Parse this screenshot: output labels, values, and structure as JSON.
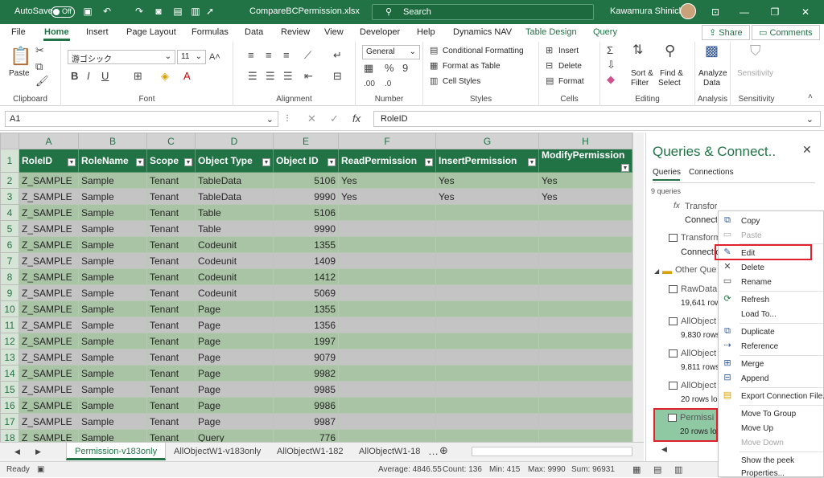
{
  "titlebar": {
    "autosave": "AutoSave",
    "toggle": "Off",
    "filename": "CompareBCPermission.xlsx",
    "search": "Search",
    "user": "Kawamura Shinichi"
  },
  "menu": {
    "items": [
      "File",
      "Home",
      "Insert",
      "Page Layout",
      "Formulas",
      "Data",
      "Review",
      "View",
      "Developer",
      "Help",
      "Dynamics NAV"
    ],
    "context": [
      "Table Design",
      "Query"
    ],
    "share": "Share",
    "comments": "Comments"
  },
  "ribbon": {
    "clipboard": {
      "label": "Clipboard",
      "paste": "Paste"
    },
    "font": {
      "label": "Font",
      "name": "游ゴシック",
      "size": "11"
    },
    "alignment": {
      "label": "Alignment"
    },
    "number": {
      "label": "Number",
      "format": "General"
    },
    "styles": {
      "label": "Styles",
      "conditional": "Conditional Formatting",
      "format_table": "Format as Table",
      "cell_styles": "Cell Styles"
    },
    "cells": {
      "label": "Cells",
      "insert": "Insert",
      "delete": "Delete",
      "format": "Format"
    },
    "editing": {
      "label": "Editing",
      "sort": "Sort &",
      "filter": "Filter",
      "find": "Find &",
      "select": "Select"
    },
    "analysis": {
      "label": "Analysis",
      "analyze": "Analyze",
      "data": "Data"
    },
    "sensitivity": {
      "label": "Sensitivity",
      "btn": "Sensitivity"
    }
  },
  "formula_bar": {
    "cell": "A1",
    "value": "RoleID"
  },
  "sheet": {
    "columns": [
      "A",
      "B",
      "C",
      "D",
      "E",
      "F",
      "G",
      "H"
    ],
    "headers": [
      "RoleID",
      "RoleName",
      "Scope",
      "Object Type",
      "Object ID",
      "ReadPermission",
      "InsertPermission",
      "ModifyPermission"
    ],
    "rows": [
      {
        "n": "2",
        "cells": [
          "Z_SAMPLE",
          "Sample",
          "Tenant",
          "TableData",
          "5106",
          "Yes",
          "Yes",
          "Yes"
        ]
      },
      {
        "n": "3",
        "cells": [
          "Z_SAMPLE",
          "Sample",
          "Tenant",
          "TableData",
          "9990",
          "Yes",
          "Yes",
          "Yes"
        ]
      },
      {
        "n": "4",
        "cells": [
          "Z_SAMPLE",
          "Sample",
          "Tenant",
          "Table",
          "5106",
          "",
          "",
          ""
        ]
      },
      {
        "n": "5",
        "cells": [
          "Z_SAMPLE",
          "Sample",
          "Tenant",
          "Table",
          "9990",
          "",
          "",
          ""
        ]
      },
      {
        "n": "6",
        "cells": [
          "Z_SAMPLE",
          "Sample",
          "Tenant",
          "Codeunit",
          "1355",
          "",
          "",
          ""
        ]
      },
      {
        "n": "7",
        "cells": [
          "Z_SAMPLE",
          "Sample",
          "Tenant",
          "Codeunit",
          "1409",
          "",
          "",
          ""
        ]
      },
      {
        "n": "8",
        "cells": [
          "Z_SAMPLE",
          "Sample",
          "Tenant",
          "Codeunit",
          "1412",
          "",
          "",
          ""
        ]
      },
      {
        "n": "9",
        "cells": [
          "Z_SAMPLE",
          "Sample",
          "Tenant",
          "Codeunit",
          "5069",
          "",
          "",
          ""
        ]
      },
      {
        "n": "10",
        "cells": [
          "Z_SAMPLE",
          "Sample",
          "Tenant",
          "Page",
          "1355",
          "",
          "",
          ""
        ]
      },
      {
        "n": "11",
        "cells": [
          "Z_SAMPLE",
          "Sample",
          "Tenant",
          "Page",
          "1356",
          "",
          "",
          ""
        ]
      },
      {
        "n": "12",
        "cells": [
          "Z_SAMPLE",
          "Sample",
          "Tenant",
          "Page",
          "1997",
          "",
          "",
          ""
        ]
      },
      {
        "n": "13",
        "cells": [
          "Z_SAMPLE",
          "Sample",
          "Tenant",
          "Page",
          "9079",
          "",
          "",
          ""
        ]
      },
      {
        "n": "14",
        "cells": [
          "Z_SAMPLE",
          "Sample",
          "Tenant",
          "Page",
          "9982",
          "",
          "",
          ""
        ]
      },
      {
        "n": "15",
        "cells": [
          "Z_SAMPLE",
          "Sample",
          "Tenant",
          "Page",
          "9985",
          "",
          "",
          ""
        ]
      },
      {
        "n": "16",
        "cells": [
          "Z_SAMPLE",
          "Sample",
          "Tenant",
          "Page",
          "9986",
          "",
          "",
          ""
        ]
      },
      {
        "n": "17",
        "cells": [
          "Z_SAMPLE",
          "Sample",
          "Tenant",
          "Page",
          "9987",
          "",
          "",
          ""
        ]
      },
      {
        "n": "18",
        "cells": [
          "Z_SAMPLE",
          "Sample",
          "Tenant",
          "Query",
          "776",
          "",
          "",
          ""
        ]
      }
    ]
  },
  "sheet_tabs": [
    "Permission-v183only",
    "AllObjectW1-v183only",
    "AllObjectW1-182",
    "AllObjectW1-18"
  ],
  "status": {
    "ready": "Ready",
    "average": "Average: 4846.55",
    "count": "Count: 136",
    "min": "Min: 415",
    "max": "Max: 9990",
    "sum": "Sum: 96931"
  },
  "pane": {
    "title": "Queries & Connect..",
    "tab_queries": "Queries",
    "tab_connections": "Connections",
    "count": "9 queries",
    "items": [
      {
        "name": "Transform File",
        "sub": "Connecti"
      },
      {
        "name": "Transform",
        "sub": "Connectio"
      },
      {
        "name": "Other Que",
        "sub": ""
      },
      {
        "name": "RawData",
        "sub": "19,641 row"
      },
      {
        "name": "AllObject",
        "sub": "9,830 rows"
      },
      {
        "name": "AllObject",
        "sub": "9,811 rows"
      },
      {
        "name": "AllObject",
        "sub": "20 rows lo"
      },
      {
        "name": "Permissi",
        "sub": "20 rows lo"
      }
    ]
  },
  "context_menu": {
    "items": [
      "Copy",
      "Paste",
      "Edit",
      "Delete",
      "Rename",
      "Refresh",
      "Load To...",
      "Duplicate",
      "Reference",
      "Merge",
      "Append",
      "Export Connection File...",
      "Move To Group",
      "Move Up",
      "Move Down",
      "Show the peek",
      "Properties..."
    ]
  }
}
